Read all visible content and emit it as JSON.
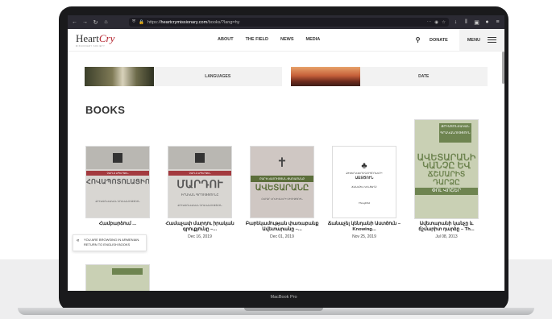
{
  "device": {
    "label": "MacBook Pro"
  },
  "browser": {
    "url_prefix": "https://",
    "url_domain": "heartcrymissionary.com",
    "url_path": "/books/?lang=hy",
    "icons": [
      "back-icon",
      "forward-icon",
      "reload-icon",
      "home-icon",
      "shield-icon",
      "lock-icon",
      "more-icon",
      "pocket-icon",
      "star-icon",
      "download-icon",
      "library-icon",
      "reader-icon",
      "account-icon",
      "menu-icon"
    ]
  },
  "site": {
    "logo_main": "Heart",
    "logo_accent": "Cry",
    "logo_sub": "MISSIONARY SOCIETY",
    "nav": [
      "ABOUT",
      "THE FIELD",
      "NEWS",
      "MEDIA"
    ],
    "donate": "DONATE",
    "menu": "MENU"
  },
  "filters": {
    "languages": "LANGUAGES",
    "date": "DATE"
  },
  "page_title": "BOOKS",
  "books": [
    {
      "cover_band": "ՉԱՐԼԶ ՍՊԵՐՋԵՆ",
      "cover_title": "ՀՈՎԱՊՈՏՈԼԱՑԻՈՑՆԵՐ",
      "cover_foot": "ՔՐԻՍՏՈՆԵԱԿԱՆ ԳՐԱԿԱՆՈՒԹՅՈՒՆ",
      "title": "Համբարձում ...",
      "date": ""
    },
    {
      "cover_band": "ՉԱՐԼԶ ՍՊԵՐՋԵՆ",
      "cover_title": "ՄԱՐԴՈՒ",
      "cover_sub": "ԻՐԱԿԱՆ ԳՐՈՒԹՅՈՒՆԸ",
      "cover_foot": "ՔՐԻՍՏՈՆԵԱԿԱՆ ԳՐԱԿԱՆՈՒԹՅՈՒՆ",
      "title": "Համաչափ մարդու իրական գրուքյունը –...",
      "date": "Dec 16, 2019"
    },
    {
      "cover_band": "ԲԱՐԵԿԱՄՈՒԹՅԱՆ ՓԱՌԱԲԱՆՔ",
      "cover_title": "ԱՎԵՏԱՐԱՆԸ",
      "cover_foot": "ԲԱՐՁՐ ՀՈՎԻՎՆԵՐԻ ՄԻՈՒԹՅՈՒՆ",
      "title": "Բարեկամության փառաբանք Ավետարանը –...",
      "date": "Dec 01, 2019"
    },
    {
      "cover_top": "ՔԻՄԵՐԱՎԵՐՋ ԳՈՐԾՈՂՆԵՐԻ",
      "cover_title": "ԱՍՏԾՈՒՆ",
      "cover_line": "ՃԱՆԱՉԵԼ ԿԵՆՑԱՂԸ",
      "cover_foot": "Thoughtful",
      "title": "Ճանաչել կենդանի Աստծուն – Knowing...",
      "date": "Nov 25, 2019"
    },
    {
      "cover_top": "ՔՐԻՍՏՈՆԵԱԿԱՆ ԳՐԱԿԱՆՈՒԹՅՈՒՆ",
      "cover_title_lines": [
        "ԱՎԵՏԱՐԱՆԻ",
        "ԿԱՆՉԸ ԵՎ",
        "ՃՇՄԱՐԻՏ ԴԱՐՁԸ"
      ],
      "cover_band": "ՓՈԼ ՎՈՇԵՐ",
      "title": "Ավետարանի կանչը և ճշմարիտ դարձը – Th...",
      "date": "Jul 08, 2013"
    }
  ],
  "toast": {
    "line1": "YOU ARE BROWSING IN ARMENIAN.",
    "line2": "RETURN TO ENGLISH BOOKS"
  }
}
